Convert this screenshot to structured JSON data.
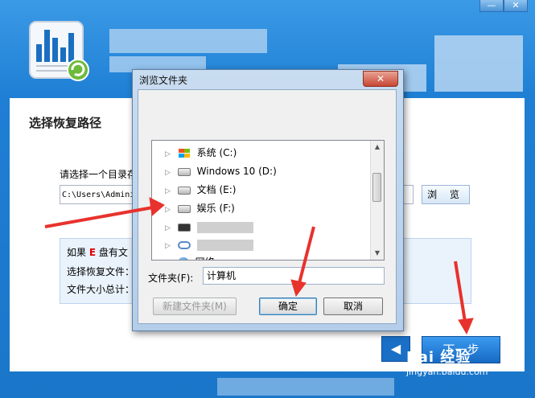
{
  "main": {
    "section_title": "选择恢复路径",
    "dir_prompt": "请选择一个目录存",
    "path_value": "C:\\Users\\Admini",
    "browse_label": "浏 览",
    "info": {
      "line1_prefix": "如果",
      "line1_drive": "E",
      "line1_suffix": "盘有文",
      "line2": "选择恢复文件：",
      "line3": "文件大小总计："
    },
    "back_icon": "◀",
    "next_label": "下一步"
  },
  "window_controls": {
    "minimize": "—",
    "close": "✕"
  },
  "dialog": {
    "title": "浏览文件夹",
    "close": "✕",
    "tree": [
      {
        "label": "系统 (C:)",
        "icon": "windows-drive-icon"
      },
      {
        "label": "Windows 10 (D:)",
        "icon": "drive-icon"
      },
      {
        "label": "文档 (E:)",
        "icon": "drive-icon"
      },
      {
        "label": "娱乐 (F:)",
        "icon": "drive-icon"
      },
      {
        "label": "",
        "icon": "removable-drive-icon"
      },
      {
        "label": "",
        "icon": "cloud-drive-icon"
      },
      {
        "label": "网络",
        "icon": "network-icon"
      }
    ],
    "scroll_up": "▲",
    "scroll_down": "▼",
    "folder_label": "文件夹(F):",
    "folder_value": "计算机",
    "new_folder_label": "新建文件夹(M)",
    "ok_label": "确定",
    "cancel_label": "取消"
  },
  "watermark": {
    "logo": "Bai 经验",
    "url": "jingyan.baidu.com"
  },
  "colors": {
    "app_blue": "#1f7fd4",
    "annotation_red": "#e8322d"
  }
}
